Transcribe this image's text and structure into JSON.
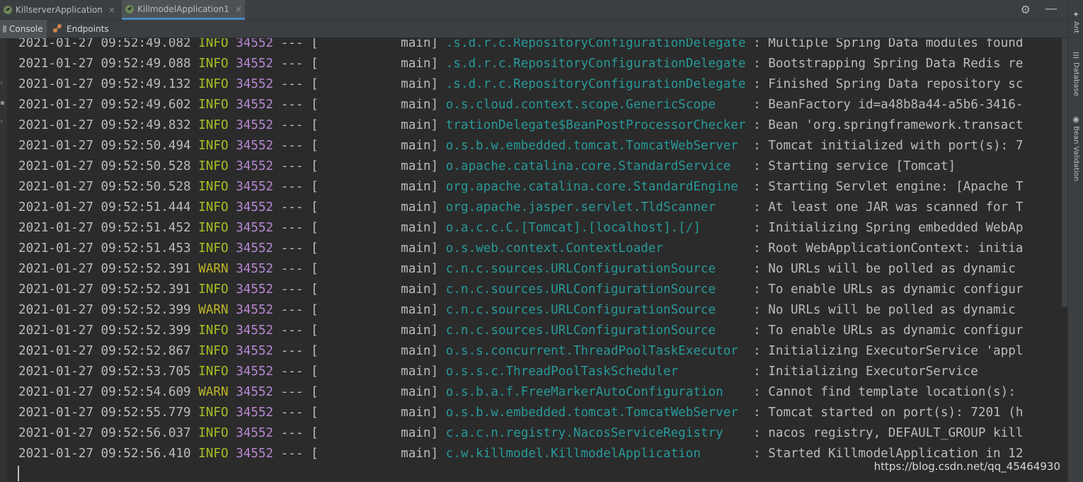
{
  "tabs": [
    {
      "label": "KillserverApplication",
      "close": "×",
      "active": false
    },
    {
      "label": "KillmodelApplication1",
      "close": "×",
      "active": true
    }
  ],
  "subtabs": [
    {
      "label": "Console",
      "active": true
    },
    {
      "label": "Endpoints",
      "active": false
    }
  ],
  "right_panel": {
    "items": [
      {
        "label": "Ant",
        "icon": "ant-icon"
      },
      {
        "label": "Database",
        "icon": "database-icon"
      },
      {
        "label": "Bean Validation",
        "icon": "bean-validation-icon"
      }
    ]
  },
  "colors": {
    "background": "#2b2b2b",
    "info": "#a8c023",
    "warn": "#bbb529",
    "pid": "#b788d3",
    "logger": "#299999",
    "text": "#bbbbbb"
  },
  "console": {
    "lines": [
      {
        "ts": "2021-01-27 09:52:49.082",
        "level": "INFO",
        "pid": "34552",
        "sep": "---",
        "thread": "[           main]",
        "logger": ".s.d.r.c.RepositoryConfigurationDelegate",
        "msg": ": Multiple Spring Data modules found"
      },
      {
        "ts": "2021-01-27 09:52:49.088",
        "level": "INFO",
        "pid": "34552",
        "sep": "---",
        "thread": "[           main]",
        "logger": ".s.d.r.c.RepositoryConfigurationDelegate",
        "msg": ": Bootstrapping Spring Data Redis re"
      },
      {
        "ts": "2021-01-27 09:52:49.132",
        "level": "INFO",
        "pid": "34552",
        "sep": "---",
        "thread": "[           main]",
        "logger": ".s.d.r.c.RepositoryConfigurationDelegate",
        "msg": ": Finished Spring Data repository sc"
      },
      {
        "ts": "2021-01-27 09:52:49.602",
        "level": "INFO",
        "pid": "34552",
        "sep": "---",
        "thread": "[           main]",
        "logger": "o.s.cloud.context.scope.GenericScope    ",
        "msg": ": BeanFactory id=a48b8a44-a5b6-3416-"
      },
      {
        "ts": "2021-01-27 09:52:49.832",
        "level": "INFO",
        "pid": "34552",
        "sep": "---",
        "thread": "[           main]",
        "logger": "trationDelegate$BeanPostProcessorChecker",
        "msg": ": Bean 'org.springframework.transact"
      },
      {
        "ts": "2021-01-27 09:52:50.494",
        "level": "INFO",
        "pid": "34552",
        "sep": "---",
        "thread": "[           main]",
        "logger": "o.s.b.w.embedded.tomcat.TomcatWebServer ",
        "msg": ": Tomcat initialized with port(s): 7"
      },
      {
        "ts": "2021-01-27 09:52:50.528",
        "level": "INFO",
        "pid": "34552",
        "sep": "---",
        "thread": "[           main]",
        "logger": "o.apache.catalina.core.StandardService  ",
        "msg": ": Starting service [Tomcat]"
      },
      {
        "ts": "2021-01-27 09:52:50.528",
        "level": "INFO",
        "pid": "34552",
        "sep": "---",
        "thread": "[           main]",
        "logger": "org.apache.catalina.core.StandardEngine ",
        "msg": ": Starting Servlet engine: [Apache T"
      },
      {
        "ts": "2021-01-27 09:52:51.444",
        "level": "INFO",
        "pid": "34552",
        "sep": "---",
        "thread": "[           main]",
        "logger": "org.apache.jasper.servlet.TldScanner    ",
        "msg": ": At least one JAR was scanned for T"
      },
      {
        "ts": "2021-01-27 09:52:51.452",
        "level": "INFO",
        "pid": "34552",
        "sep": "---",
        "thread": "[           main]",
        "logger": "o.a.c.c.C.[Tomcat].[localhost].[/]      ",
        "msg": ": Initializing Spring embedded WebAp"
      },
      {
        "ts": "2021-01-27 09:52:51.453",
        "level": "INFO",
        "pid": "34552",
        "sep": "---",
        "thread": "[           main]",
        "logger": "o.s.web.context.ContextLoader           ",
        "msg": ": Root WebApplicationContext: initia"
      },
      {
        "ts": "2021-01-27 09:52:52.391",
        "level": "WARN",
        "pid": "34552",
        "sep": "---",
        "thread": "[           main]",
        "logger": "c.n.c.sources.URLConfigurationSource    ",
        "msg": ": No URLs will be polled as dynamic "
      },
      {
        "ts": "2021-01-27 09:52:52.391",
        "level": "INFO",
        "pid": "34552",
        "sep": "---",
        "thread": "[           main]",
        "logger": "c.n.c.sources.URLConfigurationSource    ",
        "msg": ": To enable URLs as dynamic configur"
      },
      {
        "ts": "2021-01-27 09:52:52.399",
        "level": "WARN",
        "pid": "34552",
        "sep": "---",
        "thread": "[           main]",
        "logger": "c.n.c.sources.URLConfigurationSource    ",
        "msg": ": No URLs will be polled as dynamic "
      },
      {
        "ts": "2021-01-27 09:52:52.399",
        "level": "INFO",
        "pid": "34552",
        "sep": "---",
        "thread": "[           main]",
        "logger": "c.n.c.sources.URLConfigurationSource    ",
        "msg": ": To enable URLs as dynamic configur"
      },
      {
        "ts": "2021-01-27 09:52:52.867",
        "level": "INFO",
        "pid": "34552",
        "sep": "---",
        "thread": "[           main]",
        "logger": "o.s.s.concurrent.ThreadPoolTaskExecutor ",
        "msg": ": Initializing ExecutorService 'appl"
      },
      {
        "ts": "2021-01-27 09:52:53.705",
        "level": "INFO",
        "pid": "34552",
        "sep": "---",
        "thread": "[           main]",
        "logger": "o.s.s.c.ThreadPoolTaskScheduler         ",
        "msg": ": Initializing ExecutorService"
      },
      {
        "ts": "2021-01-27 09:52:54.609",
        "level": "WARN",
        "pid": "34552",
        "sep": "---",
        "thread": "[           main]",
        "logger": "o.s.b.a.f.FreeMarkerAutoConfiguration   ",
        "msg": ": Cannot find template location(s): "
      },
      {
        "ts": "2021-01-27 09:52:55.779",
        "level": "INFO",
        "pid": "34552",
        "sep": "---",
        "thread": "[           main]",
        "logger": "o.s.b.w.embedded.tomcat.TomcatWebServer ",
        "msg": ": Tomcat started on port(s): 7201 (h"
      },
      {
        "ts": "2021-01-27 09:52:56.037",
        "level": "INFO",
        "pid": "34552",
        "sep": "---",
        "thread": "[           main]",
        "logger": "c.a.c.n.registry.NacosServiceRegistry   ",
        "msg": ": nacos registry, DEFAULT_GROUP kill"
      },
      {
        "ts": "2021-01-27 09:52:56.410",
        "level": "INFO",
        "pid": "34552",
        "sep": "---",
        "thread": "[           main]",
        "logger": "c.w.killmodel.KillmodelApplication      ",
        "msg": ": Started KillmodelApplication in 12"
      }
    ]
  },
  "watermark": "https://blog.csdn.net/qq_45464930"
}
